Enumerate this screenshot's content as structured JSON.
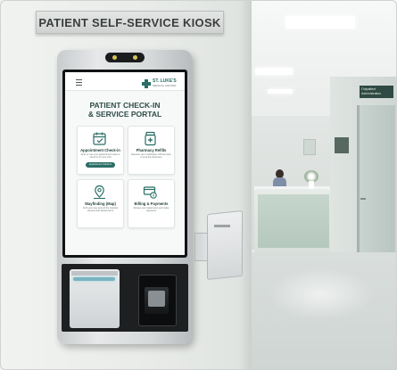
{
  "sign": {
    "text": "PATIENT SELF-SERVICE KIOSK"
  },
  "screen": {
    "logo_name": "ST. LUKE'S",
    "logo_sub": "MEDICAL CENTER",
    "title_line1": "PATIENT CHECK-IN",
    "title_line2": "& SERVICE PORTAL",
    "cards": [
      {
        "title": "Appointment Check-in",
        "desc": "Scan or use your appointment code to check in for your visit",
        "button": "Appointment Check-in",
        "icon": "calendar-icon"
      },
      {
        "title": "Pharmacy Refills",
        "desc": "Request your medication refill and pick it up at the pharmacy",
        "icon": "pill-bottle-icon"
      },
      {
        "title": "Wayfinding (Map)",
        "desc": "Find your way around the hospital campus and departments",
        "icon": "map-pin-icon"
      },
      {
        "title": "Billing & Payments",
        "desc": "Review your statements and make payments",
        "icon": "payment-card-icon"
      }
    ]
  },
  "corridor_sign": {
    "text": "Outpatient Administration"
  },
  "colors": {
    "accent": "#2a6e66",
    "title": "#2f4c48"
  }
}
